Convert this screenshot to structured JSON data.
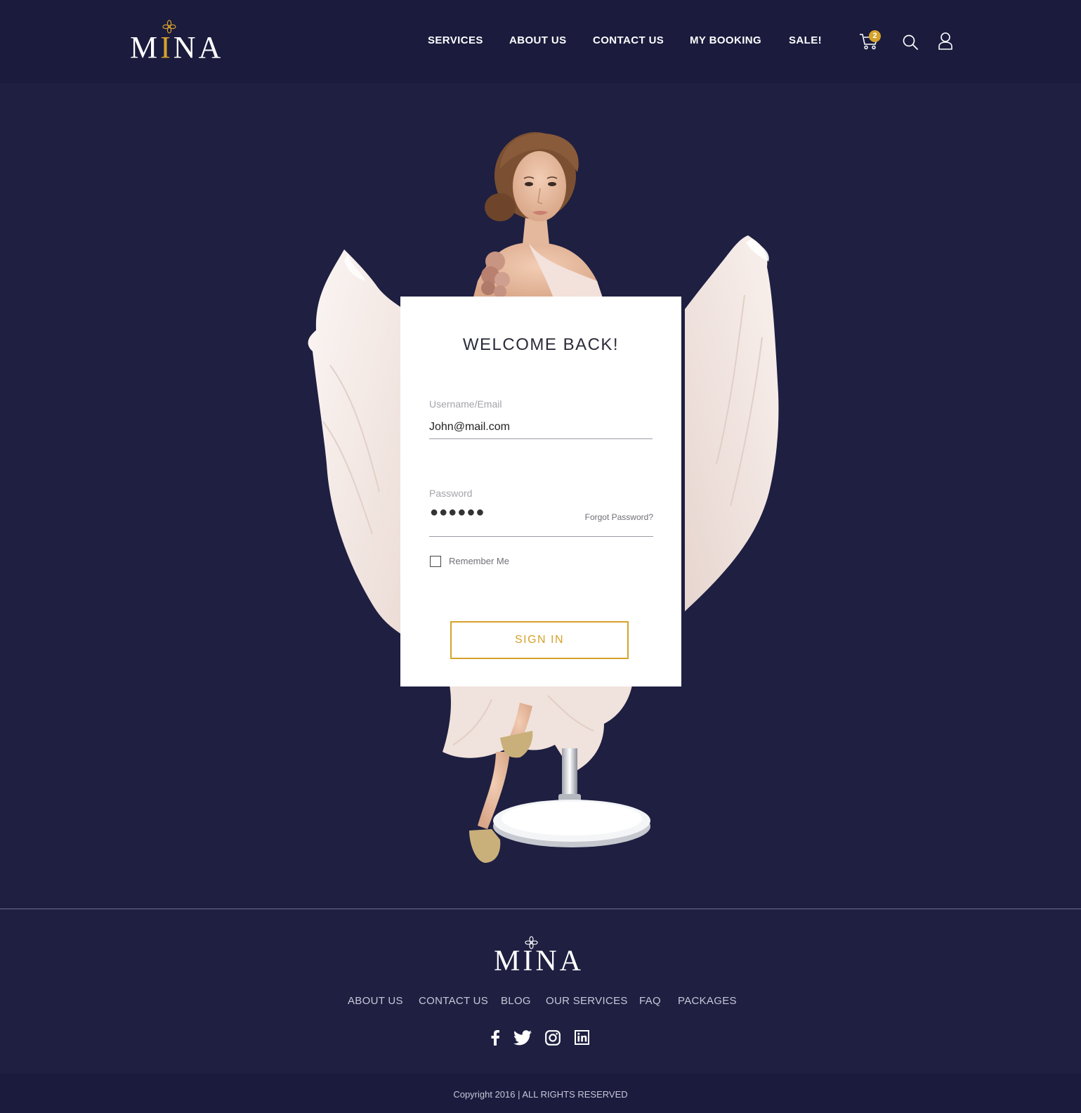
{
  "header": {
    "logo": {
      "text_prefix": "M",
      "text_accent": "I",
      "text_suffix": "NA"
    },
    "nav": [
      "SERVICES",
      "ABOUT US",
      "CONTACT US",
      "MY BOOKING",
      "SALE!"
    ],
    "cart_count": "2",
    "icons": [
      "cart-icon",
      "search-icon",
      "user-icon"
    ]
  },
  "login": {
    "title": "WELCOME BACK!",
    "username_label": "Username/Email",
    "username_value": "John@mail.com",
    "password_label": "Password",
    "password_mask": "●●●●●●",
    "forgot_label": "Forgot Password?",
    "remember_label": "Remember Me",
    "remember_checked": false,
    "signin_label": "SIGN IN"
  },
  "footer": {
    "logo": {
      "text": "MINA"
    },
    "links": [
      "ABOUT US",
      "CONTACT US",
      "BLOG",
      "OUR SERVICES",
      "FAQ",
      "PACKAGES"
    ],
    "social": [
      "facebook-icon",
      "twitter-icon",
      "instagram-icon",
      "linkedin-icon"
    ],
    "copyright": "Copyright 2016 | ALL RIGHTS RESERVED"
  },
  "colors": {
    "background": "#1e1f41",
    "header": "#1a1b3d",
    "accent_gold": "#d6a22b",
    "card": "#ffffff"
  }
}
